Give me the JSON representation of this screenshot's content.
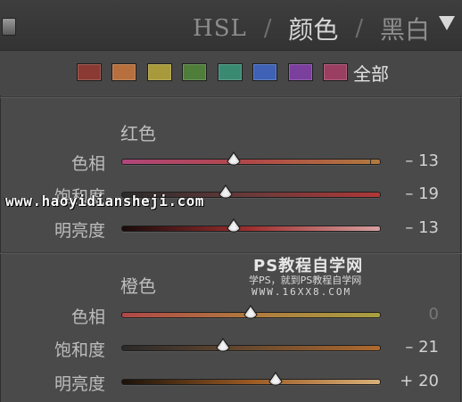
{
  "header": {
    "tabs": [
      {
        "label": "HSL",
        "active": false
      },
      {
        "label": "颜色",
        "active": true
      },
      {
        "label": "黑白",
        "active": false
      }
    ],
    "separator": "/",
    "collapse_icon": "triangle-down-icon"
  },
  "swatches": {
    "colors": [
      "#8a3a33",
      "#b7703d",
      "#a89a3a",
      "#4f7d3a",
      "#3a8a72",
      "#3f62b6",
      "#7b3f9e",
      "#9b3f62"
    ],
    "all_label": "全部"
  },
  "sections": [
    {
      "title": "红色",
      "rows": [
        {
          "label": "色相",
          "value": "– 13",
          "level": -13
        },
        {
          "label": "饱和度",
          "value": "– 19",
          "level": -19
        },
        {
          "label": "明亮度",
          "value": "– 13",
          "level": -13
        }
      ]
    },
    {
      "title": "橙色",
      "rows": [
        {
          "label": "色相",
          "value": "0",
          "level": 0
        },
        {
          "label": "饱和度",
          "value": "– 21",
          "level": -21
        },
        {
          "label": "明亮度",
          "value": "+ 20",
          "level": 20
        }
      ]
    }
  ],
  "slider_range": [
    -100,
    100
  ],
  "watermarks": {
    "url": "www.haoyidiansheji.com",
    "title": "PS教程自学网",
    "subtitle": "学PS，就到PS教程自学网",
    "site": "WWW.16XX8.COM"
  }
}
